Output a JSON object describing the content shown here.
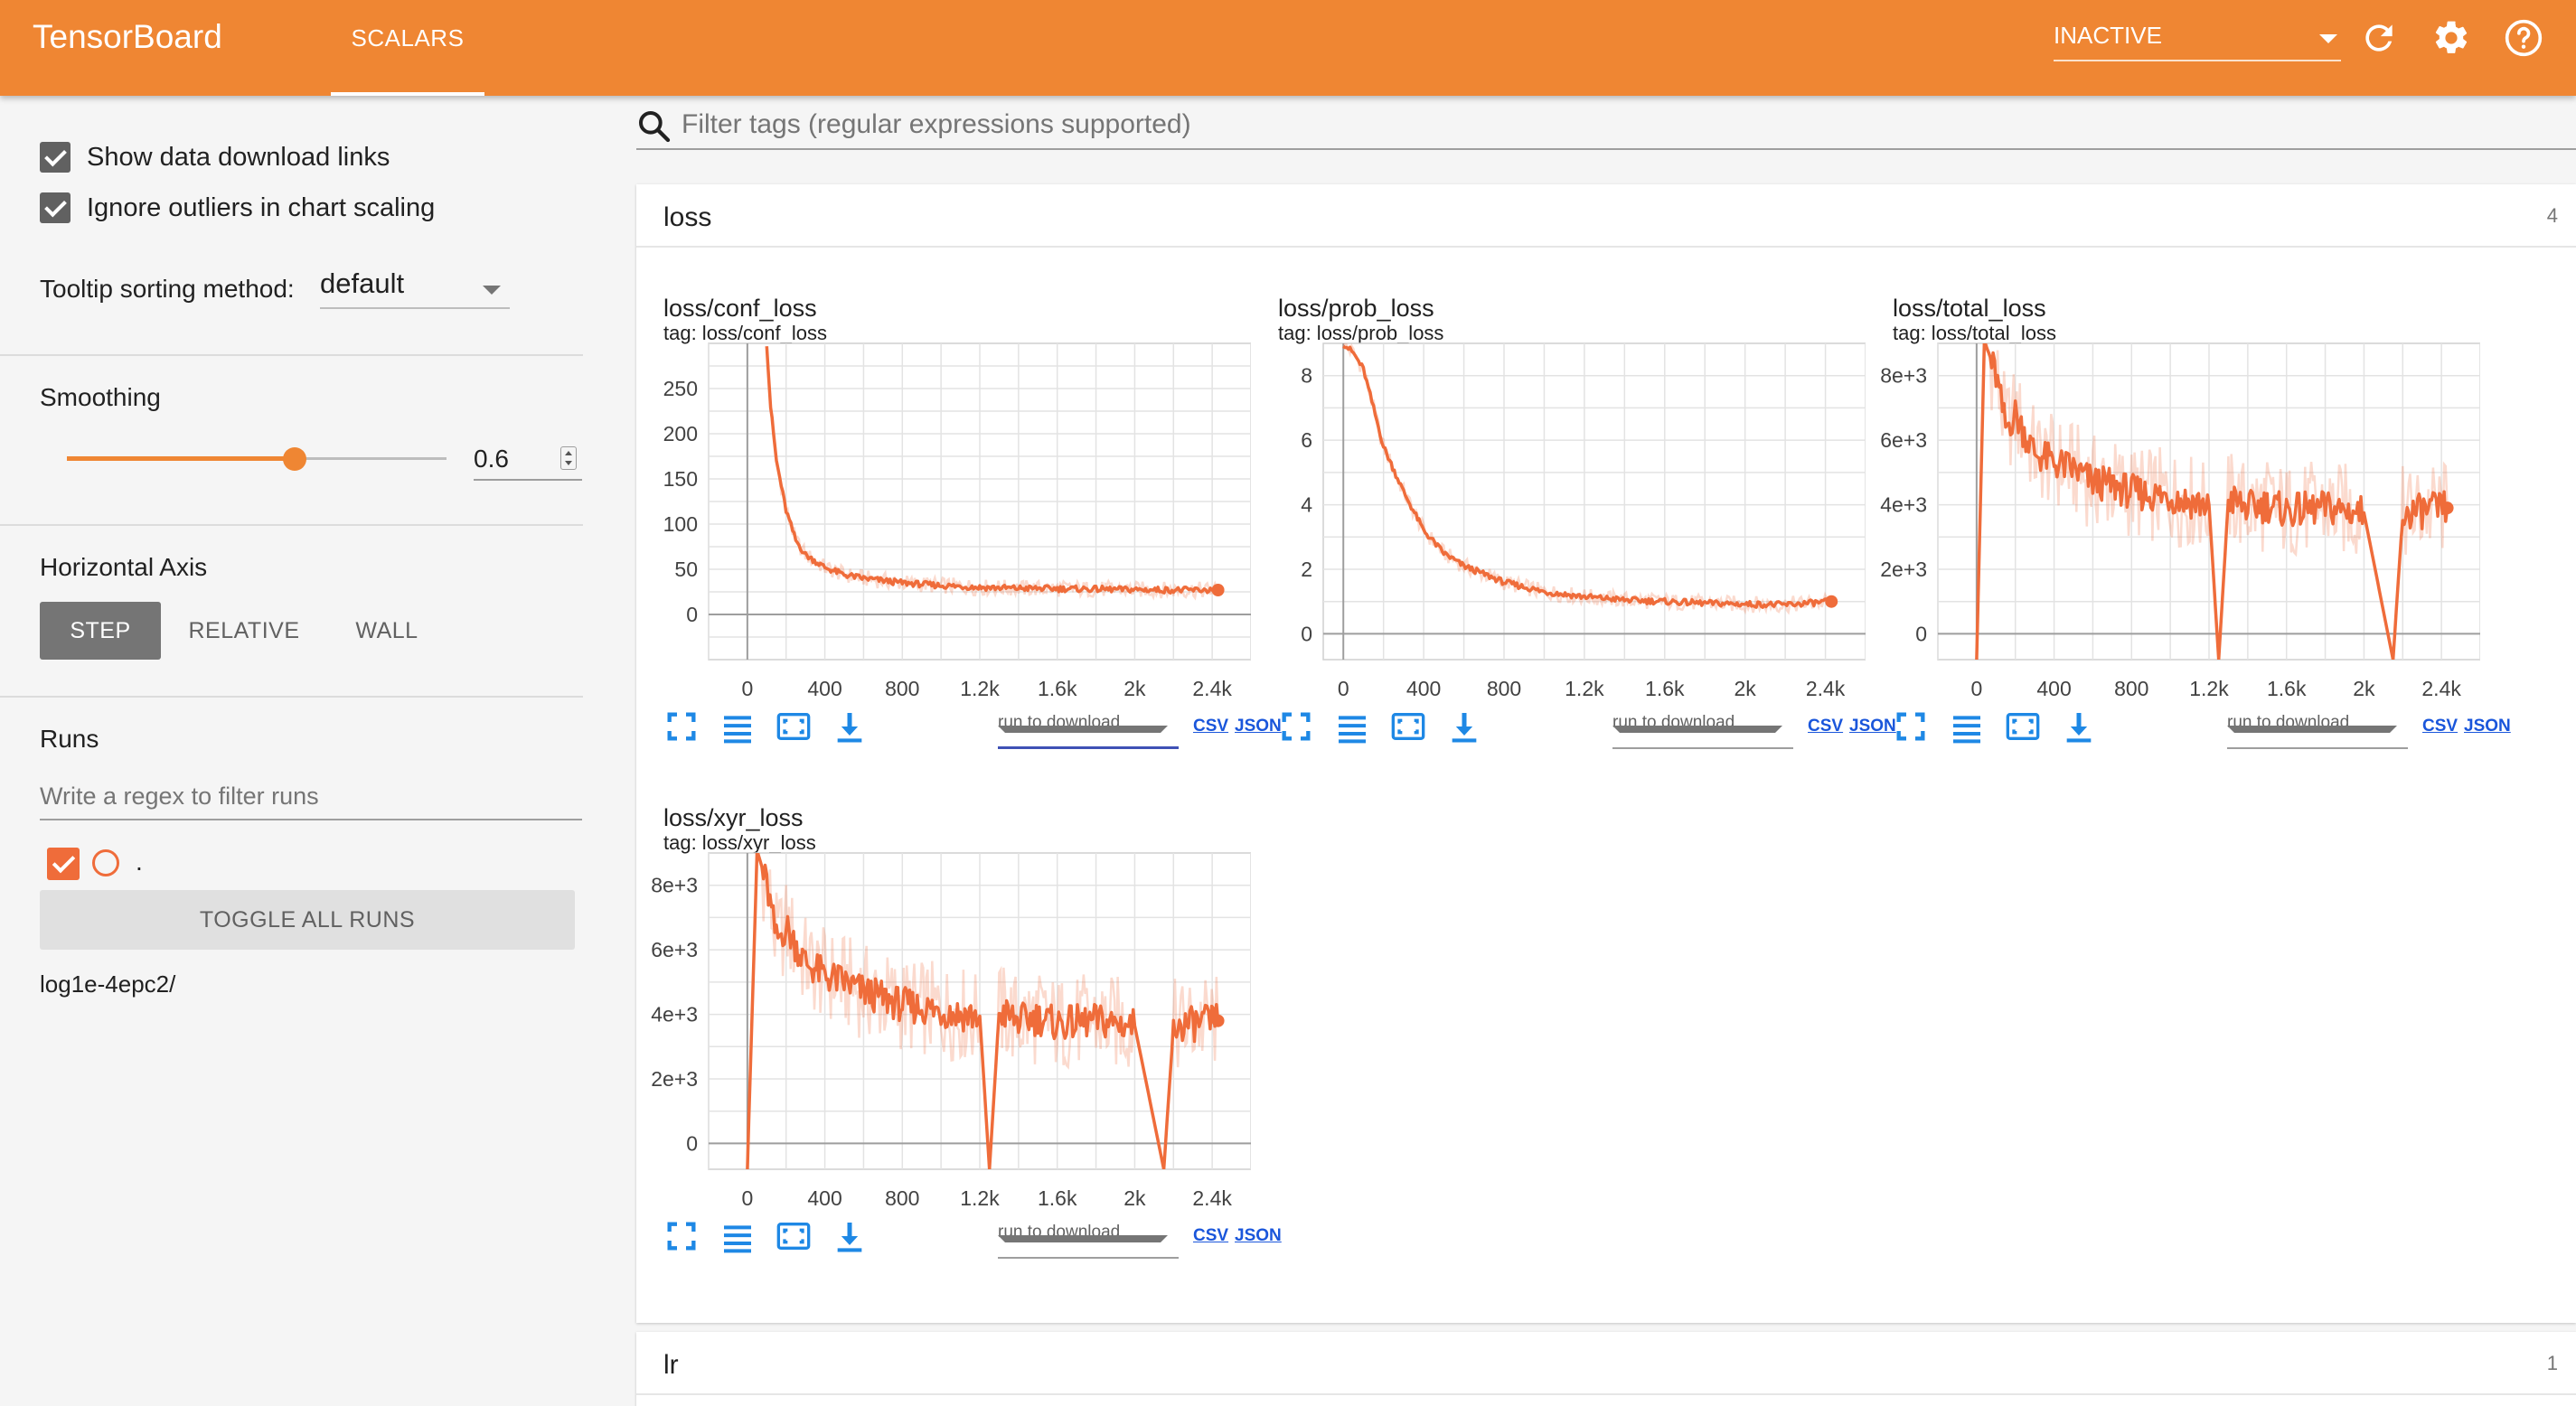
{
  "app": {
    "title": "TensorBoard",
    "tab_label": "SCALARS",
    "run_status": "INACTIVE",
    "accent_color": "#ef8633",
    "icons": [
      "refresh-icon",
      "gear-icon",
      "help-icon"
    ]
  },
  "sidebar": {
    "show_download_links_label": "Show data download links",
    "ignore_outliers_label": "Ignore outliers in chart scaling",
    "tooltip_sorting_label": "Tooltip sorting method:",
    "tooltip_sorting_value": "default",
    "smoothing_label": "Smoothing",
    "smoothing_value": "0.6",
    "smoothing_fraction": 0.6,
    "horizontal_axis_label": "Horizontal Axis",
    "axis_options": [
      "STEP",
      "RELATIVE",
      "WALL"
    ],
    "axis_selected": "STEP",
    "runs_label": "Runs",
    "runs_filter_placeholder": "Write a regex to filter runs",
    "run_dot_label": ".",
    "toggle_all_label": "TOGGLE ALL RUNS",
    "run_name": "log1e-4epc2/"
  },
  "main": {
    "filter_placeholder": "Filter tags (regular expressions supported)",
    "groups": [
      {
        "name": "loss",
        "count": "4"
      },
      {
        "name": "lr",
        "count": "1"
      }
    ],
    "download_select_placeholder": "run to download",
    "csv_label": "CSV",
    "json_label": "JSON"
  },
  "chart_data": [
    {
      "type": "line",
      "title": "loss/conf_loss",
      "subtitle": "tag: loss/conf_loss",
      "x_ticks": [
        "0",
        "400",
        "800",
        "1.2k",
        "1.6k",
        "2k",
        "2.4k"
      ],
      "y_ticks": [
        "0",
        "50",
        "100",
        "150",
        "200",
        "250"
      ],
      "xlim": [
        -200,
        2600
      ],
      "ylim": [
        -50,
        300
      ],
      "series_color": "#ef6c3a",
      "points": [
        [
          100,
          300
        ],
        [
          120,
          230
        ],
        [
          150,
          170
        ],
        [
          200,
          115
        ],
        [
          250,
          82
        ],
        [
          300,
          66
        ],
        [
          400,
          52
        ],
        [
          500,
          44
        ],
        [
          600,
          40
        ],
        [
          800,
          35
        ],
        [
          1000,
          32
        ],
        [
          1200,
          30
        ],
        [
          1400,
          29
        ],
        [
          1600,
          28.5
        ],
        [
          1800,
          28
        ],
        [
          2000,
          27.5
        ],
        [
          2200,
          27
        ],
        [
          2430,
          27
        ]
      ]
    },
    {
      "type": "line",
      "title": "loss/prob_loss",
      "subtitle": "tag: loss/prob_loss",
      "x_ticks": [
        "0",
        "400",
        "800",
        "1.2k",
        "1.6k",
        "2k",
        "2.4k"
      ],
      "y_ticks": [
        "0",
        "2",
        "4",
        "6",
        "8"
      ],
      "xlim": [
        -100,
        2600
      ],
      "ylim": [
        -0.8,
        9
      ],
      "series_color": "#ef6c3a",
      "points": [
        [
          0,
          9
        ],
        [
          50,
          8.7
        ],
        [
          100,
          8.2
        ],
        [
          150,
          7.0
        ],
        [
          200,
          5.8
        ],
        [
          300,
          4.4
        ],
        [
          400,
          3.2
        ],
        [
          500,
          2.5
        ],
        [
          600,
          2.1
        ],
        [
          800,
          1.6
        ],
        [
          1000,
          1.3
        ],
        [
          1200,
          1.15
        ],
        [
          1400,
          1.05
        ],
        [
          1600,
          1.0
        ],
        [
          1800,
          0.95
        ],
        [
          2000,
          0.92
        ],
        [
          2200,
          0.9
        ],
        [
          2430,
          1.0
        ]
      ]
    },
    {
      "type": "line",
      "title": "loss/total_loss",
      "subtitle": "tag: loss/total_loss",
      "x_ticks": [
        "0",
        "400",
        "800",
        "1.2k",
        "1.6k",
        "2k",
        "2.4k"
      ],
      "y_ticks": [
        "0",
        "2e+3",
        "4e+3",
        "6e+3",
        "8e+3"
      ],
      "xlim": [
        -200,
        2600
      ],
      "ylim": [
        -800,
        9000
      ],
      "series_color": "#ef6c3a",
      "points": [
        [
          0,
          -800
        ],
        [
          40,
          9000
        ],
        [
          100,
          8000
        ],
        [
          150,
          6400
        ],
        [
          200,
          6800
        ],
        [
          300,
          5600
        ],
        [
          400,
          5300
        ],
        [
          500,
          5100
        ],
        [
          600,
          4700
        ],
        [
          700,
          4600
        ],
        [
          800,
          4400
        ],
        [
          900,
          4300
        ],
        [
          1000,
          4250
        ],
        [
          1100,
          4100
        ],
        [
          1200,
          4000
        ],
        [
          1250,
          -800
        ],
        [
          1300,
          4200
        ],
        [
          1400,
          3900
        ],
        [
          1500,
          4000
        ],
        [
          1600,
          3800
        ],
        [
          1800,
          3900
        ],
        [
          2000,
          3750
        ],
        [
          2150,
          -800
        ],
        [
          2200,
          3700
        ],
        [
          2300,
          3800
        ],
        [
          2430,
          3900
        ]
      ]
    },
    {
      "type": "line",
      "title": "loss/xyr_loss",
      "subtitle": "tag: loss/xyr_loss",
      "x_ticks": [
        "0",
        "400",
        "800",
        "1.2k",
        "1.6k",
        "2k",
        "2.4k"
      ],
      "y_ticks": [
        "0",
        "2e+3",
        "4e+3",
        "6e+3",
        "8e+3"
      ],
      "xlim": [
        -200,
        2600
      ],
      "ylim": [
        -800,
        9000
      ],
      "series_color": "#ef6c3a",
      "points": [
        [
          0,
          -800
        ],
        [
          50,
          9000
        ],
        [
          100,
          8000
        ],
        [
          150,
          6300
        ],
        [
          200,
          6700
        ],
        [
          300,
          5600
        ],
        [
          400,
          5200
        ],
        [
          500,
          5000
        ],
        [
          600,
          4700
        ],
        [
          700,
          4500
        ],
        [
          800,
          4300
        ],
        [
          900,
          4200
        ],
        [
          1000,
          4100
        ],
        [
          1100,
          4000
        ],
        [
          1200,
          3950
        ],
        [
          1250,
          -800
        ],
        [
          1300,
          4100
        ],
        [
          1400,
          3800
        ],
        [
          1500,
          3900
        ],
        [
          1600,
          3700
        ],
        [
          1800,
          3800
        ],
        [
          2000,
          3650
        ],
        [
          2150,
          -800
        ],
        [
          2200,
          3600
        ],
        [
          2300,
          3700
        ],
        [
          2430,
          3800
        ]
      ]
    }
  ]
}
